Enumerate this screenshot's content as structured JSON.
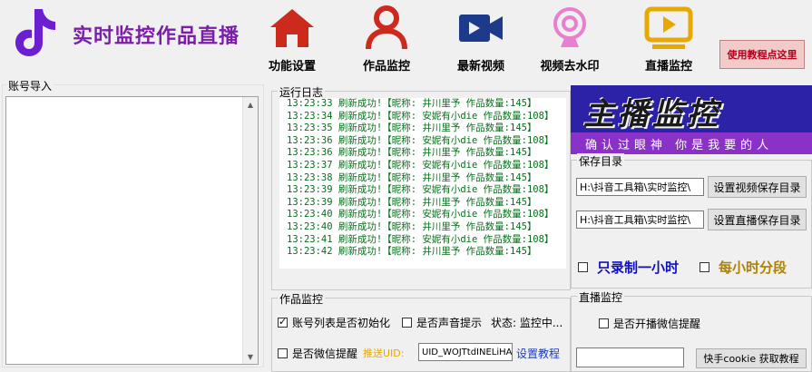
{
  "window": {
    "minimize_label": "—",
    "close_label": "✕"
  },
  "app": {
    "title": "实时监控作品直播"
  },
  "toolbar": {
    "items": [
      {
        "label": "功能设置",
        "icon": "home-icon",
        "color": "#cc2a1c"
      },
      {
        "label": "作品监控",
        "icon": "user-icon",
        "color": "#cc2a1c"
      },
      {
        "label": "最新视频",
        "icon": "video-camera-icon",
        "color": "#1e3a8a"
      },
      {
        "label": "视频去水印",
        "icon": "webcam-icon",
        "color": "#e87fcf"
      },
      {
        "label": "直播监控",
        "icon": "play-icon",
        "color": "#e8a800"
      }
    ],
    "tutorial_label": "使用教程点这里"
  },
  "account_import": {
    "label": "账号导入",
    "items": []
  },
  "log": {
    "label": "运行日志",
    "lines": [
      "13:23:33  刷新成功!【昵称: 井川里予   作品数量:145】",
      "13:23:34  刷新成功!【昵称: 安妮有小die  作品数量:108】",
      "13:23:35  刷新成功!【昵称: 井川里予   作品数量:145】",
      "13:23:36  刷新成功!【昵称: 安妮有小die  作品数量:108】",
      "13:23:36  刷新成功!【昵称: 井川里予   作品数量:145】",
      "13:23:37  刷新成功!【昵称: 安妮有小die  作品数量:108】",
      "13:23:38  刷新成功!【昵称: 井川里予   作品数量:145】",
      "13:23:39  刷新成功!【昵称: 安妮有小die  作品数量:108】",
      "13:23:39  刷新成功!【昵称: 井川里予   作品数量:145】",
      "13:23:40  刷新成功!【昵称: 安妮有小die  作品数量:108】",
      "13:23:40  刷新成功!【昵称: 井川里予   作品数量:145】",
      "13:23:41  刷新成功!【昵称: 安妮有小die  作品数量:108】",
      "13:23:42  刷新成功!【昵称: 井川里予   作品数量:145】"
    ]
  },
  "banner": {
    "main": "主播监控",
    "sub": "确认过眼神 你是我要的人"
  },
  "save_dir": {
    "label": "保存目录",
    "video_path": "H:\\抖音工具箱\\实时监控\\",
    "video_button": "设置视频保存目录",
    "live_path": "H:\\抖音工具箱\\实时监控\\",
    "live_button": "设置直播保存目录",
    "record_one_hour": {
      "label": "只录制一小时",
      "checked": false
    },
    "hourly_split": {
      "label": "每小时分段",
      "checked": false
    }
  },
  "work_monitor": {
    "label": "作品监控",
    "init_list": {
      "label": "账号列表是否初始化",
      "checked": true
    },
    "sound_alert": {
      "label": "是否声音提示",
      "checked": false
    },
    "status_label": "状态: 监控中...",
    "wechat_alert": {
      "label": "是否微信提醒",
      "checked": false
    },
    "push_uid_label": "推送UID:",
    "push_uid_value": "UID_WOJTtdINELiHA",
    "tutorial_link": "设置教程"
  },
  "live_monitor": {
    "label": "直播监控",
    "wechat_alert": {
      "label": "是否开播微信提醒",
      "checked": false
    },
    "cookie_value": "",
    "cookie_button": "快手cookie 获取教程"
  }
}
